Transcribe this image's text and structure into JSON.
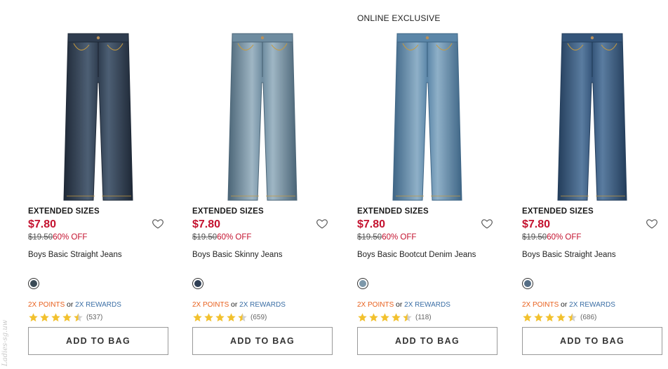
{
  "products": [
    {
      "badge": "",
      "tag": "EXTENDED SIZES",
      "price": "$7.80",
      "was": "$19.50",
      "discount": "60% OFF",
      "name": "Boys Basic Straight Jeans",
      "swatch_color": "#3a4a56",
      "rewards": {
        "points": "2X POINTS",
        "or": "or",
        "rewards": "2X REWARDS"
      },
      "rating": 4.5,
      "reviews": "(537)",
      "cta": "ADD TO BAG",
      "denim": {
        "base": "#2f3d4f",
        "light": "#4d5f74",
        "dark": "#1e2836"
      }
    },
    {
      "badge": "",
      "tag": "EXTENDED SIZES",
      "price": "$7.80",
      "was": "$19.50",
      "discount": "60% OFF",
      "name": "Boys Basic Skinny Jeans",
      "swatch_color": "#2f3f55",
      "rewards": {
        "points": "2X POINTS",
        "or": "or",
        "rewards": "2X REWARDS"
      },
      "rating": 4.5,
      "reviews": "(659)",
      "cta": "ADD TO BAG",
      "denim": {
        "base": "#6e8ca0",
        "light": "#9fb6c4",
        "dark": "#4b6577"
      }
    },
    {
      "badge": "ONLINE EXCLUSIVE",
      "tag": "EXTENDED SIZES",
      "price": "$7.80",
      "was": "$19.50",
      "discount": "60% OFF",
      "name": "Boys Basic Bootcut Denim Jeans",
      "swatch_color": "#7d98aa",
      "rewards": {
        "points": "2X POINTS",
        "or": "or",
        "rewards": "2X REWARDS"
      },
      "rating": 4.5,
      "reviews": "(118)",
      "cta": "ADD TO BAG",
      "denim": {
        "base": "#5b86a8",
        "light": "#8fb0c8",
        "dark": "#3e6585"
      }
    },
    {
      "badge": "",
      "tag": "EXTENDED SIZES",
      "price": "$7.80",
      "was": "$19.50",
      "discount": "60% OFF",
      "name": "Boys Basic Straight Jeans",
      "swatch_color": "#556e86",
      "rewards": {
        "points": "2X POINTS",
        "or": "or",
        "rewards": "2X REWARDS"
      },
      "rating": 4.5,
      "reviews": "(686)",
      "cta": "ADD TO BAG",
      "denim": {
        "base": "#35557a",
        "light": "#5a7ca0",
        "dark": "#233d5b"
      }
    }
  ],
  "watermark": "Ladies-sg.uw",
  "colors": {
    "price": "#c4122f",
    "points": "#e8601d",
    "rewards": "#3a6ea5",
    "star": "#f2c12e",
    "star_empty": "#d0d0d0"
  }
}
